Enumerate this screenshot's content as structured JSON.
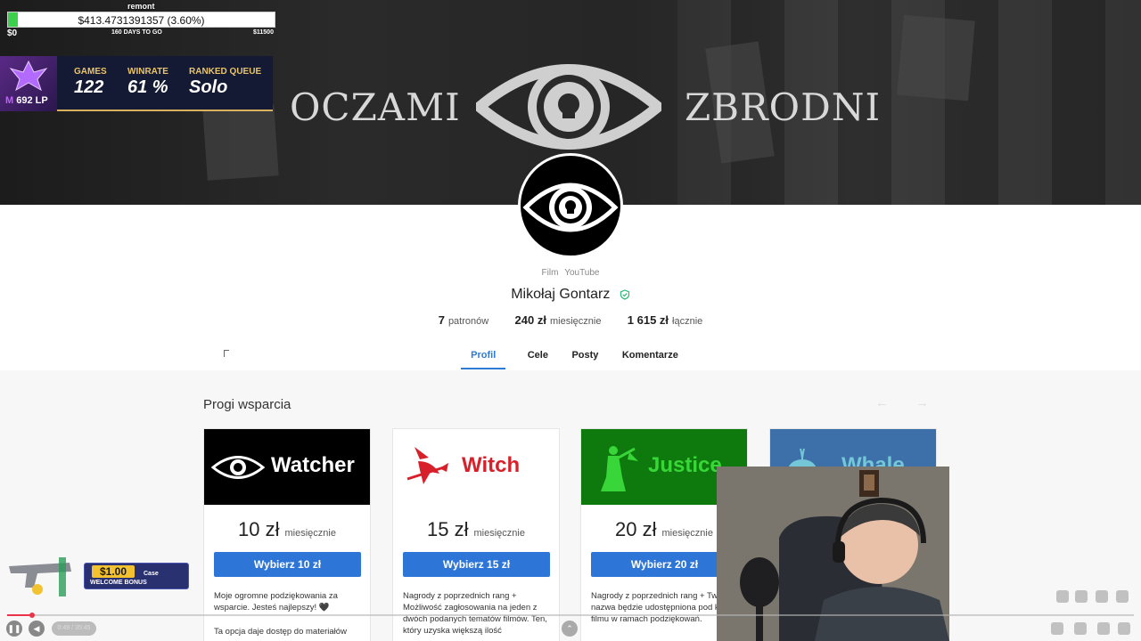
{
  "banner": {
    "word_left": "OCZAMI",
    "word_right": "ZBRODNI"
  },
  "overlay": {
    "goal_title": "remont",
    "goal_amount": "$413.4731391357 (3.60%)",
    "goal_progress": 0.036,
    "goal_start": "$0",
    "goal_days": "160 DAYS TO GO",
    "goal_end": "$11500",
    "rank_lp": "692 LP",
    "rank_letter": "M",
    "stats": [
      {
        "label": "GAMES",
        "value": "122"
      },
      {
        "label": "WINRATE",
        "value": "61 %"
      },
      {
        "label": "RANKED QUEUE",
        "value": "Solo"
      }
    ]
  },
  "profile": {
    "categories": [
      "Film",
      "YouTube"
    ],
    "name": "Mikołaj Gontarz",
    "stats": [
      {
        "value": "7",
        "unit": "patronów"
      },
      {
        "value": "240 zł",
        "unit": "miesięcznie"
      },
      {
        "value": "1 615 zł",
        "unit": "łącznie"
      }
    ],
    "tabs": [
      "Profil",
      "Cele",
      "Posty",
      "Komentarze"
    ]
  },
  "tiers": {
    "title": "Progi wsparcia",
    "items": [
      {
        "name": "Watcher",
        "price": "10 zł",
        "period": "miesięcznie",
        "button": "Wybierz 10 zł",
        "desc": "Moje ogromne podziękowania za wsparcie. Jesteś najlepszy! 🖤",
        "desc2": "Ta opcja daje dostęp do materiałów"
      },
      {
        "name": "Witch",
        "price": "15 zł",
        "period": "miesięcznie",
        "button": "Wybierz 15 zł",
        "desc": "Nagrody z poprzednich rang + Możliwość zagłosowania na jeden z dwóch podanych tematów filmów. Ten, który uzyska większą ilość",
        "desc2": ""
      },
      {
        "name": "Justice",
        "price": "20 zł",
        "period": "miesięcznie",
        "button": "Wybierz 20 zł",
        "desc": "Nagrody z poprzednich rang + Twoja nazwa będzie udostępniona pod koniec filmu w ramach podziękowań.",
        "desc2": ""
      },
      {
        "name": "Whale",
        "price": "",
        "period": "",
        "button": "",
        "desc": "",
        "desc2": ""
      }
    ]
  },
  "promo": {
    "amount": "$1.00",
    "label": "WELCOME BONUS",
    "brand": "Case"
  },
  "player": {
    "time": "0:49 / 35:45"
  },
  "colors": {
    "accent": "#2e7bd6",
    "button": "#2e75d8",
    "justice_bg": "#0e7a0e",
    "whale_bg": "#3d6fa8",
    "witch_red": "#d8202a"
  }
}
